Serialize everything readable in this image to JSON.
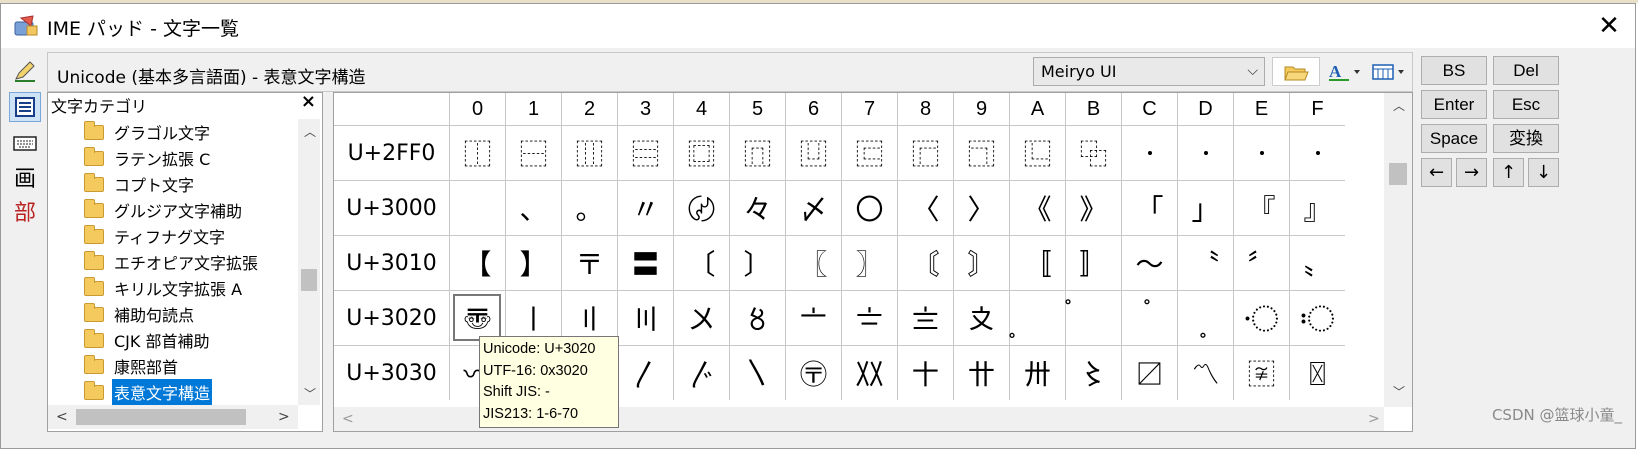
{
  "window": {
    "title": "IME パッド - 文字一覧",
    "close_glyph": "✕"
  },
  "toolbar": {
    "unicode_label": "Unicode (基本多言語面) - 表意文字構造",
    "font_name": "Meiryo UI"
  },
  "left_tools": [
    {
      "name": "handwriting-tool",
      "glyph": "✍"
    },
    {
      "name": "char-list-tool",
      "glyph": "▦"
    },
    {
      "name": "soft-keyboard-tool",
      "glyph": "⌨"
    },
    {
      "name": "stroke-count-tool",
      "glyph": "画"
    },
    {
      "name": "radical-tool",
      "glyph": "部"
    }
  ],
  "category_panel": {
    "title": "文字カテゴリ",
    "close": "×",
    "items": [
      "グラゴル文字",
      "ラテン拡張 C",
      "コプト文字",
      "グルジア文字補助",
      "ティフナグ文字",
      "エチオピア文字拡張",
      "キリル文字拡張 A",
      "補助句読点",
      "CJK 部首補助",
      "康熙部首",
      "表意文字構造"
    ],
    "selected_index": 10
  },
  "grid": {
    "columns": [
      "0",
      "1",
      "2",
      "3",
      "4",
      "5",
      "6",
      "7",
      "8",
      "9",
      "A",
      "B",
      "C",
      "D",
      "E",
      "F"
    ],
    "rows": [
      {
        "label": "U+2FF0",
        "cells": [
          "⿰",
          "⿱",
          "⿲",
          "⿳",
          "⿴",
          "⿵",
          "⿶",
          "⿷",
          "⿸",
          "⿹",
          "⿺",
          "⿻",
          "",
          "",
          "",
          ""
        ]
      },
      {
        "label": "U+3000",
        "cells": [
          "",
          "、",
          "。",
          "〃",
          "〄",
          "々",
          "〆",
          "〇",
          "〈",
          "〉",
          "《",
          "》",
          "「",
          "」",
          "『",
          "』"
        ]
      },
      {
        "label": "U+3010",
        "cells": [
          "【",
          "】",
          "〒",
          "〓",
          "〔",
          "〕",
          "〖",
          "〗",
          "〘",
          "〙",
          "〚",
          "〛",
          "〜",
          "〝",
          "〞",
          "〟"
        ]
      },
      {
        "label": "U+3020",
        "cells": [
          "〠",
          "〡",
          "〢",
          "〣",
          "〤",
          "〥",
          "〦",
          "〧",
          "〨",
          "〩",
          "〪",
          "〫",
          "〬",
          "〭",
          "〮",
          "〯"
        ]
      },
      {
        "label": "U+3030",
        "cells": [
          "〰",
          "〱",
          "〲",
          "〳",
          "〴",
          "〵",
          "〶",
          "〷",
          "〸",
          "〹",
          "〺",
          "〻",
          "〼",
          "〽",
          "〾",
          "〿"
        ]
      }
    ],
    "selected": "U+3020"
  },
  "tooltip": {
    "line1": "Unicode: U+3020",
    "line2": "UTF-16: 0x3020",
    "line3": "Shift JIS: -",
    "line4": "JIS213: 1-6-70"
  },
  "keys": {
    "bs": "BS",
    "del": "Del",
    "enter": "Enter",
    "esc": "Esc",
    "space": "Space",
    "henkan": "変換",
    "left": "←",
    "right": "→",
    "up": "↑",
    "down": "↓"
  },
  "watermark": "CSDN @篮球小童_"
}
